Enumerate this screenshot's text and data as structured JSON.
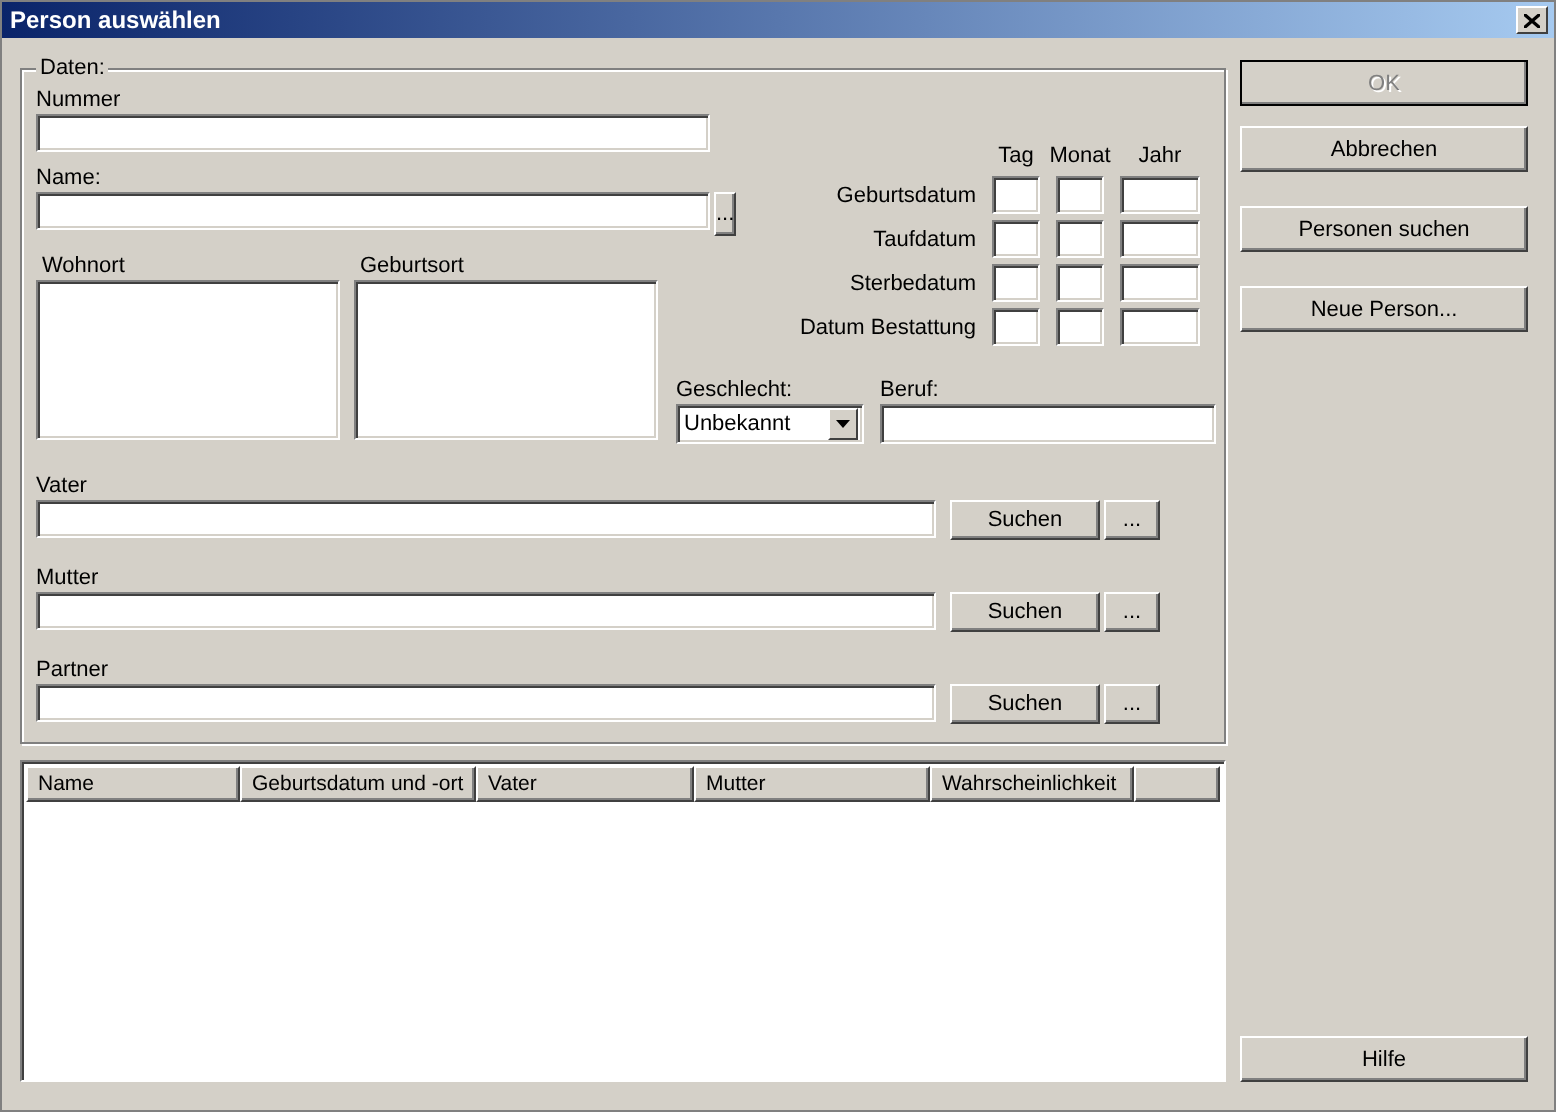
{
  "window": {
    "title": "Person auswählen"
  },
  "group": {
    "legend": "Daten:"
  },
  "nummer": {
    "label": "Nummer"
  },
  "name": {
    "label": "Name:",
    "button": "..."
  },
  "places": [
    {
      "label": "Wohnort"
    },
    {
      "label": "Geburtsort"
    }
  ],
  "dates": {
    "columns": [
      "Tag",
      "Monat",
      "Jahr"
    ],
    "rows": [
      "Geburtsdatum",
      "Taufdatum",
      "Sterbedatum",
      "Datum Bestattung"
    ]
  },
  "geschlecht": {
    "label": "Geschlecht:",
    "value": "Unbekannt"
  },
  "beruf": {
    "label": "Beruf:"
  },
  "relations": [
    {
      "label": "Vater",
      "button": "Suchen",
      "more": "..."
    },
    {
      "label": "Mutter",
      "button": "Suchen",
      "more": "..."
    },
    {
      "label": "Partner",
      "button": "Suchen",
      "more": "..."
    }
  ],
  "table": {
    "columns": [
      "Name",
      "Geburtsdatum und -ort",
      "Vater",
      "Mutter",
      "Wahrscheinlichkeit"
    ]
  },
  "buttons": [
    {
      "label": "OK",
      "disabled": true,
      "default": true
    },
    {
      "label": "Abbrechen",
      "disabled": false,
      "default": false
    },
    {
      "label": "Personen suchen",
      "disabled": false,
      "default": false
    },
    {
      "label": "Neue Person...",
      "disabled": false,
      "default": false
    }
  ],
  "help_button": {
    "label": "Hilfe"
  }
}
